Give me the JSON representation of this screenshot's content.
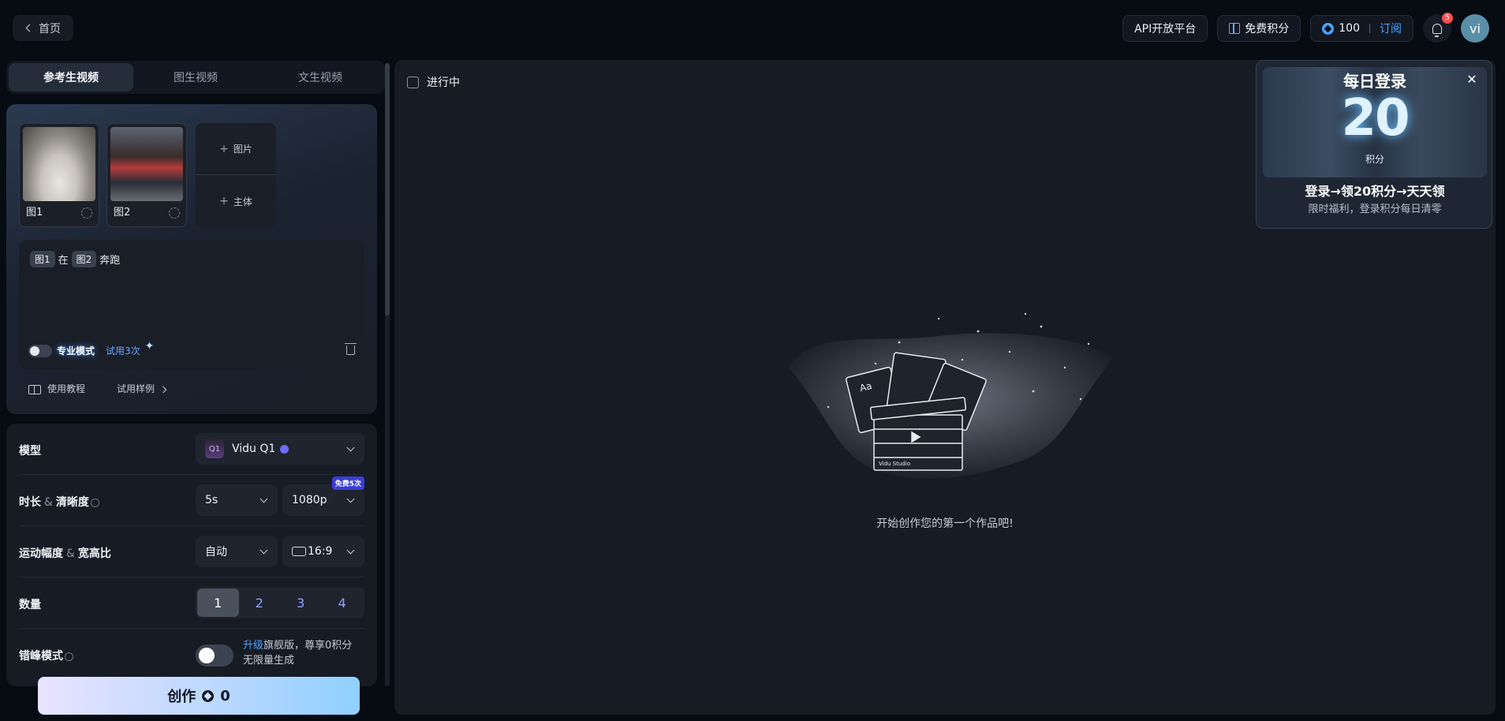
{
  "topbar": {
    "home_label": "首页",
    "api_label": "API开放平台",
    "free_points_label": "免费积分",
    "points_value": "100",
    "subscribe_label": "订阅",
    "notification_count": "5",
    "avatar_initials": "vi"
  },
  "tabs": [
    {
      "label": "参考生视频",
      "active": true
    },
    {
      "label": "图生视频",
      "active": false
    },
    {
      "label": "文生视频",
      "active": false
    }
  ],
  "references": {
    "items": [
      {
        "label": "图1"
      },
      {
        "label": "图2"
      }
    ],
    "add_image_label": "图片",
    "add_subject_label": "主体"
  },
  "prompt": {
    "chip1": "图1",
    "word1": "在",
    "chip2": "图2",
    "word2": "奔跑",
    "pro_mode_label": "专业模式",
    "trial_label": "试用3次"
  },
  "links": {
    "tutorial_label": "使用教程",
    "examples_label": "试用样例"
  },
  "settings": {
    "model_label": "模型",
    "model_value": "Vidu Q1",
    "model_icon_text": "Q1",
    "duration_label": "时长",
    "resolution_label": "清晰度",
    "duration_value": "5s",
    "resolution_value": "1080p",
    "free_badge": "免费5次",
    "motion_label": "运动幅度",
    "ratio_label": "宽高比",
    "motion_value": "自动",
    "ratio_value": "16:9",
    "quantity_label": "数量",
    "quantity_options": [
      "1",
      "2",
      "3",
      "4"
    ],
    "quantity_selected": "1",
    "offpeak_label": "错峰模式",
    "offpeak_upgrade": "升级",
    "offpeak_text_line1": "旗舰版，尊享0积分",
    "offpeak_text_line2": "无限量生成"
  },
  "create": {
    "label": "创作",
    "cost": "0"
  },
  "main": {
    "in_progress_label": "进行中",
    "empty_text": "开始创作您的第一个作品吧!",
    "clapper_text": "Vidu Studio",
    "card_text": "Aa"
  },
  "daily_popup": {
    "title": "每日登录",
    "number": "20",
    "unit": "积分",
    "headline": "登录→领20积分→天天领",
    "subtitle": "限时福利，登录积分每日清零"
  },
  "colors": {
    "accent": "#4aa3ff",
    "background": "#070b12",
    "panel": "#171b24",
    "badge_red": "#ff4d4f"
  }
}
